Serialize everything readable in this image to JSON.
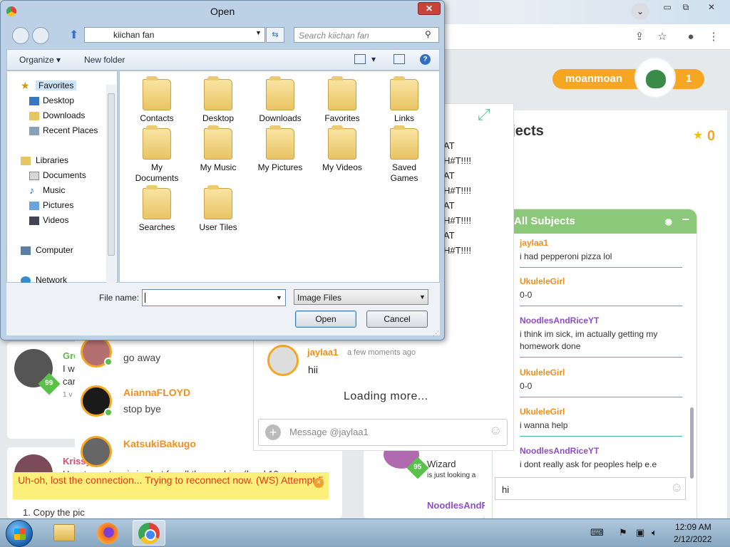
{
  "browser": {
    "tabs_dropdown_icon": "chevron-down-icon",
    "window_controls": {
      "minimize": "▭",
      "maximize": "⧉",
      "close": "✕"
    },
    "toolbar_icons": [
      "share-icon",
      "star-icon",
      "profile-icon",
      "menu-icon"
    ]
  },
  "site": {
    "user": {
      "name": "moanmoan",
      "level_count": "1"
    },
    "subjects_title": "bjects",
    "star_count": "0",
    "all_subjects": {
      "title": "All Subjects",
      "messages": [
        {
          "user": "jaylaa1",
          "text": "i had pepperoni pizza lol",
          "color": "orange"
        },
        {
          "user": "UkuleleGirl",
          "text": "0-0",
          "color": "orange"
        },
        {
          "user": "NoodlesAndRiceYT",
          "text": "i think im sick, im actually getting my homework done",
          "color": "purple"
        },
        {
          "user": "UkuleleGirl",
          "text": "0-0",
          "color": "orange"
        },
        {
          "user": "UkuleleGirl",
          "text": "i wanna help",
          "color": "orange"
        },
        {
          "user": "NoodlesAndRiceYT",
          "text": "i dont really ask for peoples help e.e",
          "color": "purple"
        }
      ],
      "input_value": "hi"
    },
    "chat": {
      "lines": [
        "AT",
        "H#T!!!!",
        "AT",
        "H#T!!!!",
        "AT",
        "H#T!!!!",
        "AT",
        "H#T!!!!"
      ],
      "last_message": {
        "user": "jaylaa1",
        "time": "a few moments ago",
        "text": "hii"
      },
      "loading_text": "Loading more...",
      "input_placeholder": "Message @jaylaa1"
    },
    "dm_list": [
      {
        "name": "",
        "status": "go away"
      },
      {
        "name": "AiannaFLOYD",
        "status": "stop bye"
      },
      {
        "name": "KatsukiBakugo",
        "status": ""
      }
    ],
    "feed": {
      "card1": {
        "name": "Gre",
        "line1": "I w",
        "line2": "car",
        "meta": "1 v",
        "level": "99"
      },
      "card2": {
        "name": "Krissy525",
        "text": "How to post a pic in chat for all the newbies (level 10 and",
        "list_item": "1. Copy the pic"
      },
      "card3": {
        "name": "Wizard",
        "text": "is just looking a",
        "level": "95"
      },
      "card4": {
        "name": "NoodlesAndR"
      }
    },
    "connection_warning": "Uh-oh, lost the connection... Trying to reconnect now. (WS) Attempt 5"
  },
  "dialog": {
    "title": "Open",
    "close_label": "✕",
    "path": [
      "kiichan fan"
    ],
    "search_placeholder": "Search kiichan fan",
    "toolbar": {
      "organize": "Organize",
      "new_folder": "New folder"
    },
    "nav": {
      "favorites": "Favorites",
      "favorites_items": [
        "Desktop",
        "Downloads",
        "Recent Places"
      ],
      "libraries": "Libraries",
      "libraries_items": [
        "Documents",
        "Music",
        "Pictures",
        "Videos"
      ],
      "computer": "Computer",
      "network": "Network"
    },
    "folders": [
      "Contacts",
      "Desktop",
      "Downloads",
      "Favorites",
      "Links",
      "My Documents",
      "My Music",
      "My Pictures",
      "My Videos",
      "Saved Games",
      "Searches",
      "User Tiles"
    ],
    "file_name_label": "File name:",
    "file_name_value": "",
    "file_type": "Image Files",
    "open_button": "Open",
    "cancel_button": "Cancel"
  },
  "taskbar": {
    "apps": [
      "windows-explorer",
      "firefox",
      "chrome"
    ],
    "time": "12:09 AM",
    "date": "2/12/2022"
  }
}
